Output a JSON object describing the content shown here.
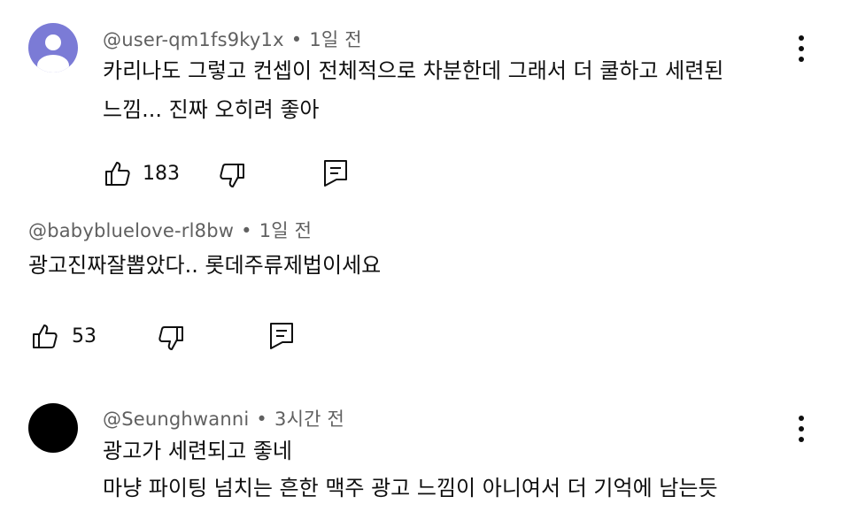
{
  "comments": [
    {
      "author": "@user-qm1fs9ky1x",
      "separator": "•",
      "time": "1일 전",
      "lines": [
        "카리나도 그렇고 컨셉이 전체적으로 차분한데 그래서 더 쿨하고 세련된",
        "느낌... 진짜 오히려 좋아"
      ],
      "likes": "183",
      "avatar": "default-person-icon",
      "avatar_color": "#7b7bd6"
    },
    {
      "author": "@babybluelove-rl8bw",
      "separator": "•",
      "time": "1일 전",
      "lines": [
        "광고진짜잘뽑았다.. 롯데주류제법이세요"
      ],
      "likes": "53"
    },
    {
      "author": "@Seunghwanni",
      "separator": "•",
      "time": "3시간 전",
      "lines": [
        "광고가 세련되고 좋네",
        "마냥 파이팅 넘치는 흔한 맥주 광고 느낌이 아니여서 더 기억에 남는듯"
      ],
      "avatar_color": "#000000"
    }
  ],
  "icons": {
    "like": "thumbs-up-icon",
    "dislike": "thumbs-down-icon",
    "reply": "reply-icon",
    "more": "more-vert-icon"
  }
}
